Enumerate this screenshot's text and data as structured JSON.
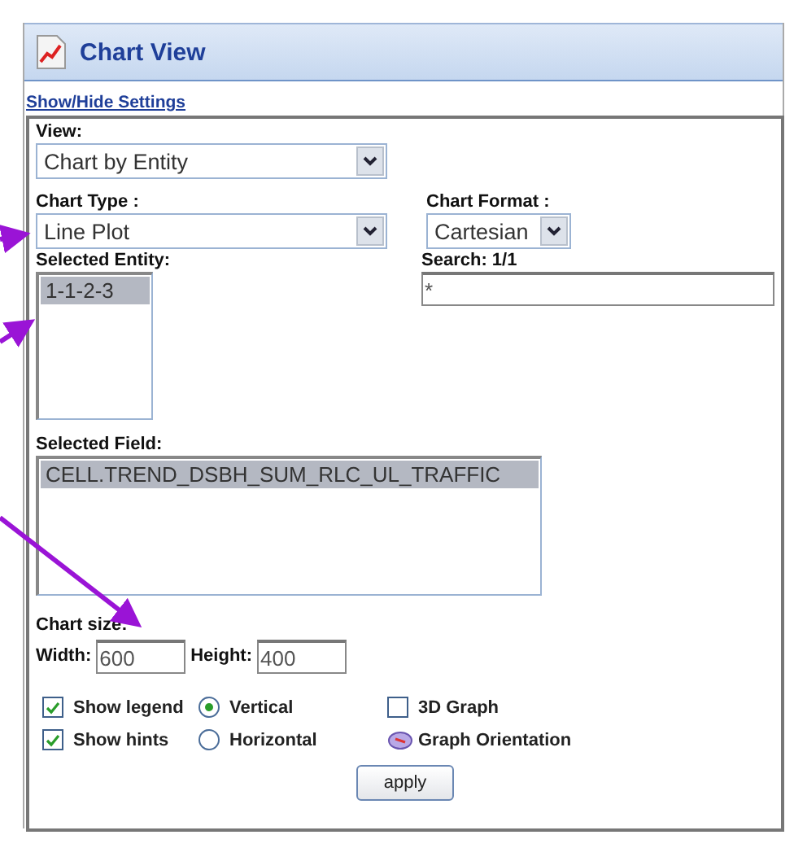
{
  "window": {
    "title": "Chart View"
  },
  "settings_link": "Show/Hide Settings",
  "view": {
    "label": "View:",
    "value": "Chart by Entity"
  },
  "chart_type": {
    "label": "Chart Type :",
    "value": "Line Plot"
  },
  "chart_format": {
    "label": "Chart Format :",
    "value": "Cartesian"
  },
  "selected_entity": {
    "label": "Selected Entity:",
    "items": [
      {
        "text": "1-1-2-3",
        "selected": true
      }
    ]
  },
  "search": {
    "label": "Search: 1/1",
    "value": "*"
  },
  "selected_field": {
    "label": "Selected Field:",
    "items": [
      {
        "text": "CELL.TREND_DSBH_SUM_RLC_UL_TRAFFIC",
        "selected": true
      }
    ]
  },
  "chart_size": {
    "label": "Chart size:",
    "width": {
      "label": "Width:",
      "value": "600"
    },
    "height": {
      "label": "Height:",
      "value": "400"
    }
  },
  "options": [
    {
      "kind": "checkbox",
      "label": "Show legend",
      "checked": true
    },
    {
      "kind": "radio",
      "label": "Vertical",
      "selected": true
    },
    {
      "kind": "checkbox",
      "label": "3D Graph",
      "checked": false
    },
    {
      "kind": "checkbox",
      "label": "Show hints",
      "checked": true
    },
    {
      "kind": "radio",
      "label": "Horizontal",
      "selected": false
    },
    {
      "kind": "button",
      "label": "Graph Orientation"
    }
  ],
  "apply_button": "apply"
}
